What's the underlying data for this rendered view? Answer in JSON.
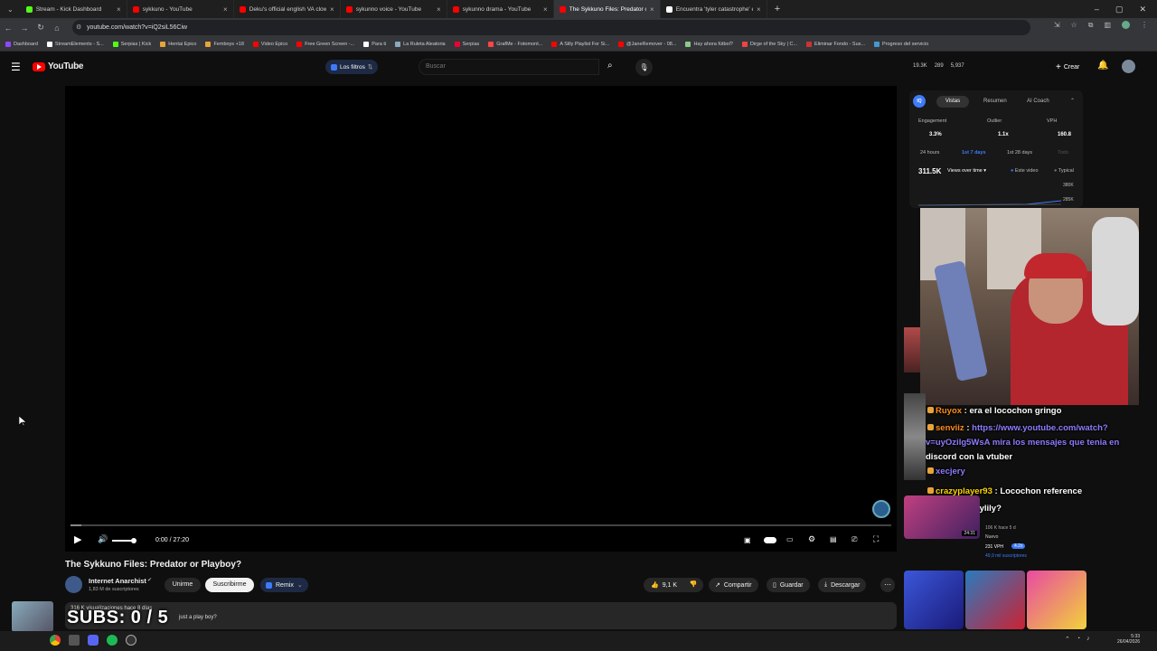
{
  "tabs": [
    {
      "title": "Stream - Kick Dashboard",
      "color": "#53fc18",
      "active": false
    },
    {
      "title": "sykkuno - YouTube",
      "color": "#ff0000",
      "active": false
    },
    {
      "title": "Deku's official english VA clow",
      "color": "#ff0000",
      "active": false
    },
    {
      "title": "sykunno voice - YouTube",
      "color": "#ff0000",
      "active": false
    },
    {
      "title": "sykunno drama - YouTube",
      "color": "#ff0000",
      "active": false
    },
    {
      "title": "The Sykkuno Files: Predator or",
      "color": "#ff0000",
      "active": true
    },
    {
      "title": "Encuentra 'tyler catastrophe' en",
      "color": "#ffffff",
      "active": false
    }
  ],
  "browser": {
    "url": "youtube.com/watch?v=iQ2siL56Ciw"
  },
  "bookmarks": [
    "Dashboard",
    "StreamElements - S...",
    "Serpias | Kick",
    "Hentai Epico",
    "Femboys +18",
    "Video Epico",
    "Free Green Screen -...",
    "Para ti",
    "La Ruleta Aleatoria",
    "Serpias",
    "GrafMe - Fotomont...",
    "A Silly Playlist For Si...",
    "@JaneRemover - 08...",
    "Hay ahora fútbol?",
    "Dirge of the Sky | C...",
    "Eliminar Fondo - Sus...",
    "Progreso del servicio"
  ],
  "youtube": {
    "logo": "YouTube",
    "filters_label": "Los filtros",
    "search_placeholder": "Buscar",
    "stats": [
      "19.3K",
      "289",
      "5,937"
    ],
    "create_label": "Crear"
  },
  "player": {
    "time": "0:00 / 27:20"
  },
  "video": {
    "title": "The Sykkuno Files: Predator or Playboy?",
    "channel": "Internet Anarchist",
    "subscribers": "1,83 M de suscriptores",
    "join_label": "Unirme",
    "subscribe_label": "Suscribirme",
    "remix_label": "Remix",
    "likes": "9,1 K",
    "share_label": "Compartir",
    "save_label": "Guardar",
    "download_label": "Descargar",
    "views_line": "316 K visualizaciones  hace 8 días",
    "desc_fragment": "just a play boy?",
    "subs_overlay": "SUBS: 0 / 5"
  },
  "panel": {
    "tabs": [
      "Vistas",
      "Resumen",
      "AI Coach"
    ],
    "metrics": [
      {
        "label": "Engagement",
        "value": "3.3%"
      },
      {
        "label": "Outlier",
        "value": "1.1x"
      },
      {
        "label": "VPH",
        "value": "160.8"
      }
    ],
    "ranges": [
      "24 hours",
      "1st 7 days",
      "1st 28 days",
      "Todo"
    ],
    "views_total": "311.5K",
    "views_dropdown": "Views over time",
    "legend": [
      "Este video",
      "Typical"
    ],
    "axis": [
      "380K",
      "285K"
    ]
  },
  "chat": [
    {
      "user": "Ruyox",
      "msg": "era el locochon gringo",
      "ucolor": "#ff8c1a"
    },
    {
      "user": "senviiz",
      "msg": "https://www.youtube.com/watch?",
      "ucolor": "#ff8c1a"
    },
    {
      "user": "",
      "msg": "v=uyOziIg5WsA  mira los mensajes que tenia en",
      "ucolor": "#8c7cff"
    },
    {
      "user": "",
      "msg": "discord con la vtuber",
      "ucolor": "#ffffff"
    },
    {
      "user": "xecjery",
      "msg": "",
      "ucolor": "#8c7cff"
    },
    {
      "user": "crazyplayer93",
      "msg": "Locochon reference",
      "ucolor": "#ffd700"
    },
    {
      "user": "Ruyox",
      "msg": "shylily?",
      "ucolor": "#ff8c1a"
    }
  ],
  "suggested": {
    "vph": "231 VPH",
    "ratio": "4.2x",
    "subs": "49,9 mil suscriptores",
    "views": "106 K  hace 5 d",
    "badge": "Nuevo",
    "duration": "24:31"
  },
  "clock": {
    "time": "5:33",
    "date": "26/04/2026"
  }
}
